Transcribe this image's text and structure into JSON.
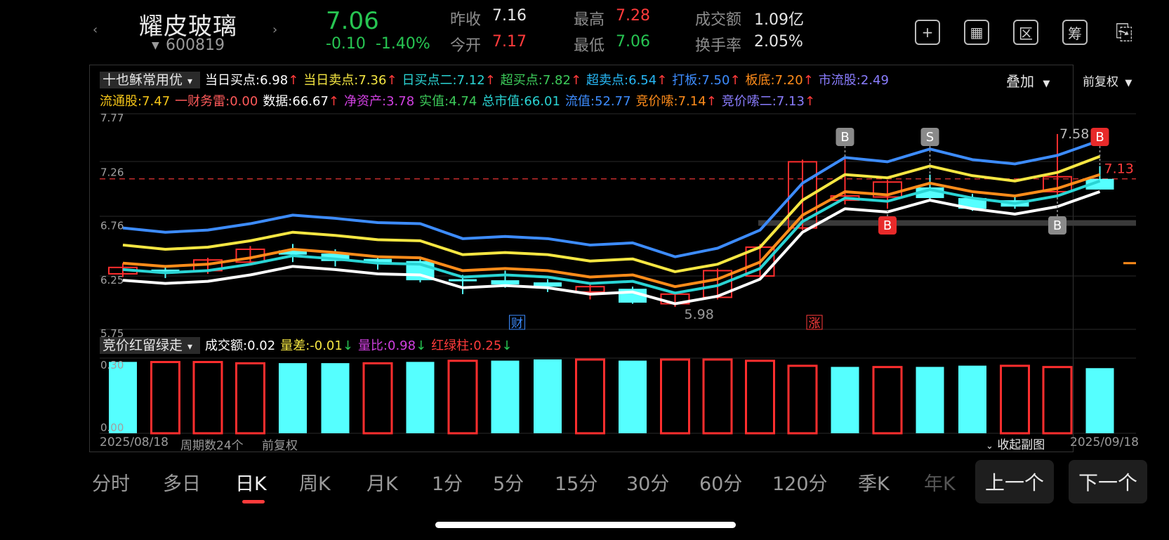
{
  "header": {
    "name": "耀皮玻璃",
    "code": "600819",
    "price": "7.06",
    "change": "-0.10",
    "change_pct": "-1.40%",
    "stats": [
      {
        "label": "昨收",
        "value": "7.16",
        "color": "#e6e6e6"
      },
      {
        "label": "今开",
        "value": "7.17",
        "color": "#ff3b3b"
      },
      {
        "label": "最高",
        "value": "7.28",
        "color": "#ff3b3b"
      },
      {
        "label": "最低",
        "value": "7.06",
        "color": "#27c552"
      },
      {
        "label": "成交额",
        "value": "1.09亿",
        "color": "#e6e6e6"
      },
      {
        "label": "换手率",
        "value": "2.05%",
        "color": "#e6e6e6"
      }
    ],
    "icons": [
      {
        "name": "add-watchlist-icon",
        "glyph": "+"
      },
      {
        "name": "chart-view-icon",
        "glyph": "▦"
      },
      {
        "name": "range-icon",
        "glyph": "区"
      },
      {
        "name": "chip-icon",
        "glyph": "筹"
      },
      {
        "name": "share-device-icon",
        "glyph": "⎘"
      }
    ]
  },
  "main_indicator": {
    "selector": "十也稣常用优",
    "overlay": "叠加",
    "adjust": "前复权",
    "row1": [
      {
        "text": "当日买点:6.98",
        "arrow": "↑",
        "color": "#ffffff"
      },
      {
        "text": "当日卖点:7.36",
        "arrow": "↑",
        "color": "#f5e642"
      },
      {
        "text": "日买点二:7.12",
        "arrow": "↑",
        "color": "#2ad4d4"
      },
      {
        "text": "超买点:7.82",
        "arrow": "↑",
        "color": "#3dcc5a"
      },
      {
        "text": "超卖点:6.54",
        "arrow": "↑",
        "color": "#27b7f5"
      },
      {
        "text": "打板:7.50",
        "arrow": "↑",
        "color": "#3d8cff"
      },
      {
        "text": "板底:7.20",
        "arrow": "↑",
        "color": "#ff8c1a"
      },
      {
        "text": "市流股:2.49",
        "arrow": "",
        "color": "#8a7dff"
      }
    ],
    "row2": [
      {
        "text": "流通股:7.47",
        "arrow": "",
        "color": "#f5c518"
      },
      {
        "text": "一财务雷:0.00",
        "arrow": "",
        "color": "#ff5a5a"
      },
      {
        "text": "数据:66.67",
        "arrow": "↑",
        "color": "#ffffff"
      },
      {
        "text": "净资产:3.78",
        "arrow": "",
        "color": "#d040e0"
      },
      {
        "text": "实值:4.74",
        "arrow": "",
        "color": "#3dcc5a"
      },
      {
        "text": "总市值:66.01",
        "arrow": "",
        "color": "#2ad4d4"
      },
      {
        "text": "流值:52.77",
        "arrow": "",
        "color": "#3d8cff"
      },
      {
        "text": "竞价嗦:7.14",
        "arrow": "↑",
        "color": "#ff8c1a"
      },
      {
        "text": "竞价嗦二:7.13",
        "arrow": "↑",
        "color": "#8a7dff"
      }
    ]
  },
  "sub_indicator": {
    "selector": "竞价红留绿走",
    "items": [
      {
        "text": "成交额:0.02",
        "arrow": "",
        "color": "#ffffff"
      },
      {
        "text": "量差:-0.01",
        "arrow": "↓",
        "color": "#f5e642"
      },
      {
        "text": "量比:0.98",
        "arrow": "↓",
        "color": "#d040e0"
      },
      {
        "text": "红绿柱:0.25",
        "arrow": "↓",
        "color": "#ff3b3b"
      }
    ],
    "ylabels": [
      "0.30",
      "0.00"
    ],
    "collapse": "收起副图"
  },
  "footer": {
    "start_date": "2025/08/18",
    "period_count": "周期数24个",
    "adjust": "前复权",
    "end_date": "2025/09/18"
  },
  "periods": [
    "分时",
    "多日",
    "日K",
    "周K",
    "月K",
    "1分",
    "5分",
    "15分",
    "30分",
    "60分",
    "120分",
    "季K",
    "年K"
  ],
  "active_period": "日K",
  "nav": {
    "prev": "上一个",
    "next": "下一个"
  },
  "chart_data": {
    "type": "candlestick",
    "ylim": [
      5.75,
      7.77
    ],
    "yticks": [
      "7.77",
      "7.26",
      "6.76",
      "6.25",
      "5.75"
    ],
    "ref_line": 7.16,
    "ref_label": "7.13",
    "high_label": "7.58",
    "low_label": "5.98",
    "candles": [
      {
        "o": 6.27,
        "c": 6.33,
        "h": 6.37,
        "l": 6.24
      },
      {
        "o": 6.31,
        "c": 6.28,
        "h": 6.33,
        "l": 6.23
      },
      {
        "o": 6.3,
        "c": 6.4,
        "h": 6.42,
        "l": 6.27
      },
      {
        "o": 6.38,
        "c": 6.5,
        "h": 6.53,
        "l": 6.35
      },
      {
        "o": 6.49,
        "c": 6.45,
        "h": 6.55,
        "l": 6.38
      },
      {
        "o": 6.46,
        "c": 6.39,
        "h": 6.5,
        "l": 6.34
      },
      {
        "o": 6.41,
        "c": 6.37,
        "h": 6.44,
        "l": 6.31
      },
      {
        "o": 6.39,
        "c": 6.21,
        "h": 6.41,
        "l": 6.19
      },
      {
        "o": 6.22,
        "c": 6.2,
        "h": 6.26,
        "l": 6.08
      },
      {
        "o": 6.21,
        "c": 6.17,
        "h": 6.3,
        "l": 6.14
      },
      {
        "o": 6.19,
        "c": 6.15,
        "h": 6.22,
        "l": 6.1
      },
      {
        "o": 6.1,
        "c": 6.15,
        "h": 6.18,
        "l": 6.03
      },
      {
        "o": 6.13,
        "c": 6.0,
        "h": 6.15,
        "l": 5.99
      },
      {
        "o": 5.99,
        "c": 6.08,
        "h": 6.1,
        "l": 5.96
      },
      {
        "o": 6.05,
        "c": 6.3,
        "h": 6.32,
        "l": 6.03
      },
      {
        "o": 6.25,
        "c": 6.52,
        "h": 6.55,
        "l": 6.21
      },
      {
        "o": 6.7,
        "c": 7.32,
        "h": 7.34,
        "l": 6.68
      },
      {
        "o": 6.96,
        "c": 7.0,
        "h": 7.35,
        "l": 6.92
      },
      {
        "o": 6.99,
        "c": 7.13,
        "h": 7.15,
        "l": 6.88
      },
      {
        "o": 7.08,
        "c": 6.98,
        "h": 7.2,
        "l": 6.95
      },
      {
        "o": 6.98,
        "c": 6.88,
        "h": 7.02,
        "l": 6.86
      },
      {
        "o": 6.96,
        "c": 6.9,
        "h": 7.0,
        "l": 6.88
      },
      {
        "o": 7.04,
        "c": 7.18,
        "h": 7.58,
        "l": 7.0
      },
      {
        "o": 7.16,
        "c": 7.06,
        "h": 7.28,
        "l": 7.06
      }
    ],
    "lines": [
      {
        "color": "#3d8cff",
        "values": [
          6.7,
          6.66,
          6.68,
          6.74,
          6.82,
          6.79,
          6.75,
          6.74,
          6.6,
          6.62,
          6.6,
          6.54,
          6.56,
          6.43,
          6.51,
          6.68,
          7.12,
          7.36,
          7.32,
          7.44,
          7.34,
          7.3,
          7.38,
          7.52
        ]
      },
      {
        "color": "#f5e642",
        "values": [
          6.54,
          6.5,
          6.52,
          6.58,
          6.66,
          6.63,
          6.59,
          6.58,
          6.45,
          6.47,
          6.45,
          6.39,
          6.41,
          6.29,
          6.36,
          6.52,
          6.96,
          7.2,
          7.17,
          7.28,
          7.19,
          7.14,
          7.22,
          7.37
        ]
      },
      {
        "color": "#ff8c1a",
        "values": [
          6.37,
          6.34,
          6.36,
          6.42,
          6.5,
          6.47,
          6.43,
          6.42,
          6.3,
          6.32,
          6.3,
          6.24,
          6.26,
          6.15,
          6.22,
          6.38,
          6.82,
          7.04,
          7.01,
          7.12,
          7.04,
          7.0,
          7.07,
          7.2
        ]
      },
      {
        "color": "#2ad4d4",
        "values": [
          6.31,
          6.28,
          6.3,
          6.36,
          6.44,
          6.41,
          6.37,
          6.36,
          6.24,
          6.26,
          6.24,
          6.18,
          6.2,
          6.09,
          6.16,
          6.32,
          6.76,
          6.98,
          6.95,
          7.06,
          6.98,
          6.93,
          7.0,
          7.14
        ]
      },
      {
        "color": "#ffffff",
        "values": [
          6.21,
          6.18,
          6.2,
          6.26,
          6.34,
          6.31,
          6.27,
          6.26,
          6.14,
          6.16,
          6.14,
          6.08,
          6.1,
          5.99,
          6.06,
          6.22,
          6.66,
          6.88,
          6.85,
          6.96,
          6.88,
          6.83,
          6.9,
          7.04
        ]
      }
    ],
    "signals": [
      {
        "i": 17,
        "label": "B",
        "kind": "gray",
        "pos": "top"
      },
      {
        "i": 19,
        "label": "S",
        "kind": "gray",
        "pos": "top"
      },
      {
        "i": 18,
        "label": "B",
        "kind": "red",
        "pos": "bottom"
      },
      {
        "i": 22,
        "label": "B",
        "kind": "gray",
        "pos": "bottom"
      },
      {
        "i": 23,
        "label": "B",
        "kind": "red",
        "pos": "top"
      }
    ],
    "events": [
      {
        "i": 9,
        "label": "财",
        "color": "#3d8cff"
      },
      {
        "i": 16,
        "label": "涨",
        "color": "#ff3b3b"
      }
    ],
    "volume": {
      "ylim": [
        0,
        0.3
      ],
      "values": [
        0.285,
        0.29,
        0.29,
        0.285,
        0.28,
        0.28,
        0.285,
        0.285,
        0.295,
        0.29,
        0.295,
        0.3,
        0.29,
        0.3,
        0.3,
        0.295,
        0.275,
        0.265,
        0.27,
        0.265,
        0.27,
        0.275,
        0.27,
        0.26
      ],
      "up": [
        false,
        true,
        true,
        true,
        false,
        false,
        true,
        false,
        true,
        false,
        false,
        true,
        false,
        true,
        true,
        true,
        true,
        false,
        true,
        false,
        false,
        true,
        true,
        false
      ]
    }
  }
}
